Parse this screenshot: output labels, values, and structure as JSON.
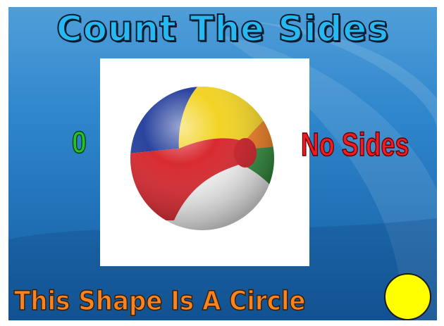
{
  "slide": {
    "title": "Count The Sides",
    "side_count": "0",
    "sides_label": "No Sides",
    "caption": "This Shape Is A Circle"
  },
  "image": {
    "subject_icon": "beach-ball"
  },
  "shape": {
    "name_icon": "yellow-circle",
    "color": "#ffff00"
  },
  "colors": {
    "title": "#27b8f2",
    "count": "#22c02a",
    "sides_label": "#ee1c24",
    "caption": "#f7841e",
    "background": "#2f86cc"
  }
}
